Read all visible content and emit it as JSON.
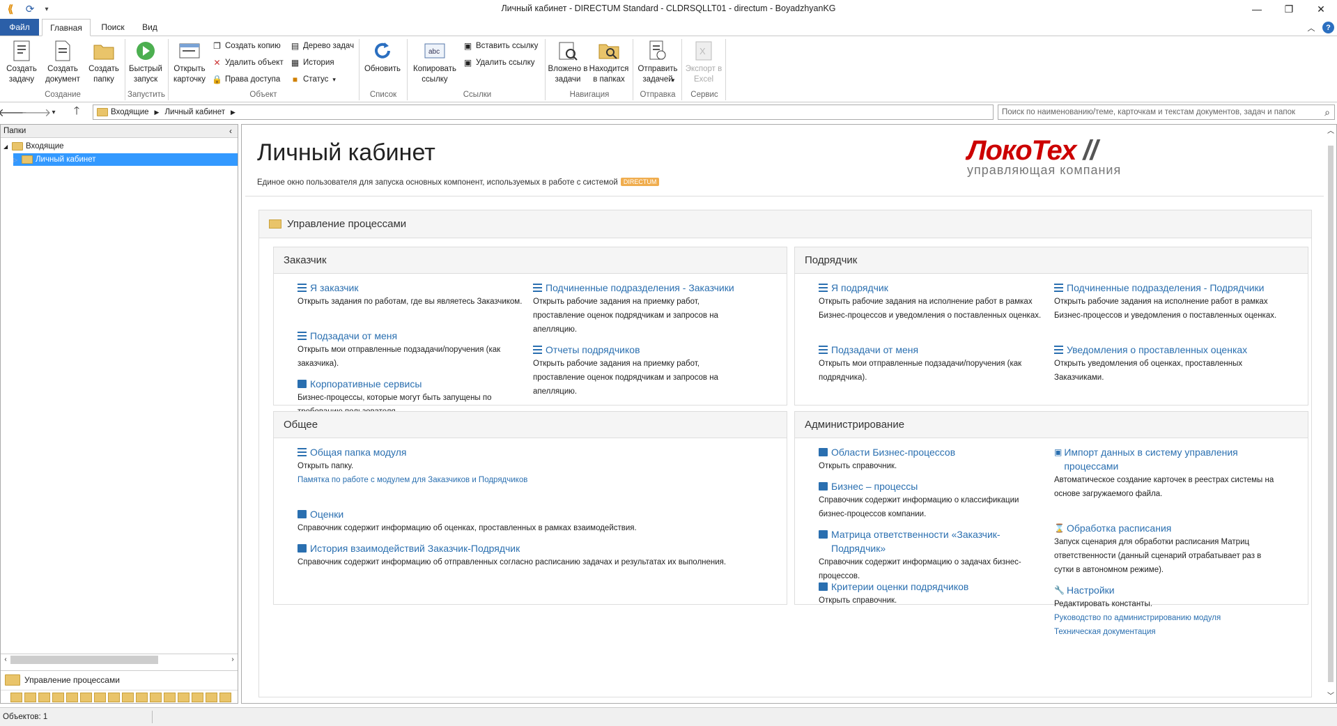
{
  "window": {
    "title": "Личный кабинет - DIRECTUM Standard - CLDRSQLLT01 - directum - BoyadzhyanKG"
  },
  "tabs": [
    "Файл",
    "Главная",
    "Поиск",
    "Вид"
  ],
  "ribbon": {
    "create_task": "Создать задачу",
    "create_doc": "Создать документ",
    "create_folder": "Создать папку",
    "group_create": "Создание",
    "quick_start": "Быстрый запуск",
    "group_run": "Запустить",
    "open_card": "Открыть карточку",
    "create_copy": "Создать копию",
    "delete_object": "Удалить объект",
    "access_rights": "Права доступа",
    "task_tree": "Дерево задач",
    "history": "История",
    "status": "Статус",
    "group_object": "Объект",
    "refresh": "Обновить",
    "group_list": "Список",
    "copy_link": "Копировать ссылку",
    "insert_link": "Вставить ссылку",
    "delete_link": "Удалить ссылку",
    "group_links": "Ссылки",
    "attached": "Вложено в задачи",
    "in_folders": "Находится в папках",
    "group_nav": "Навигация",
    "send_tasks": "Отправить задачей",
    "group_send": "Отправка",
    "export_excel": "Экспорт в Excel",
    "group_service": "Сервис"
  },
  "breadcrumb": {
    "root": "Входящие",
    "current": "Личный кабинет"
  },
  "search": {
    "placeholder": "Поиск по наименованию/теме, карточкам и текстам документов, задач и папок"
  },
  "left": {
    "header": "Папки",
    "tree": [
      "Входящие",
      "Личный кабинет"
    ],
    "navpane": "Управление процессами"
  },
  "page": {
    "title": "Личный кабинет",
    "subtitle": "Единое окно пользователя для запуска основных компонент, используемых в работе с системой",
    "badge": "DIRECTUM",
    "logo_main": "ЛокоТех",
    "logo_sub": "управляющая компания",
    "section": "Управление процессами"
  },
  "customer": {
    "header": "Заказчик",
    "items": [
      {
        "title": "Я заказчик",
        "desc": "Открыть задания по работам, где вы являетесь Заказчиком."
      },
      {
        "title": "Подзадачи от меня",
        "desc": "Открыть мои отправленные подзадачи/поручения (как заказчика)."
      },
      {
        "title": "Корпоративные сервисы",
        "desc": "Бизнес-процессы, которые могут быть запущены по требованию пользователя."
      },
      {
        "title": "Подчиненные подразделения - Заказчики",
        "desc": "Открыть рабочие задания на приемку работ, проставление оценок подрядчикам и запросов на апелляцию."
      },
      {
        "title": "Отчеты подрядчиков",
        "desc": "Открыть рабочие задания на приемку работ, проставление оценок подрядчикам и запросов на апелляцию."
      }
    ]
  },
  "contractor": {
    "header": "Подрядчик",
    "items": [
      {
        "title": "Я подрядчик",
        "desc": "Открыть рабочие задания на исполнение работ в рамках Бизнес-процессов и уведомления о поставленных оценках."
      },
      {
        "title": "Подзадачи от меня",
        "desc": "Открыть мои отправленные подзадачи/поручения (как подрядчика)."
      },
      {
        "title": "Подчиненные подразделения - Подрядчики",
        "desc": "Открыть рабочие задания на исполнение работ в рамках Бизнес-процессов и уведомления о поставленных оценках."
      },
      {
        "title": "Уведомления о проставленных оценках",
        "desc": "Открыть уведомления об оценках, проставленных Заказчиками."
      }
    ]
  },
  "general": {
    "header": "Общее",
    "items": [
      {
        "title": "Общая папка модуля",
        "desc": "Открыть папку.",
        "sub": "Памятка по работе с модулем для Заказчиков и Подрядчиков"
      },
      {
        "title": "Оценки",
        "desc": "Справочник содержит информацию об оценках, проставленных в рамках взаимодействия."
      },
      {
        "title": "История взаимодействий Заказчик-Подрядчик",
        "desc": "Справочник содержит информацию об отправленных согласно расписанию задачах и результатах их выполнения."
      }
    ]
  },
  "admin": {
    "header": "Администрирование",
    "items": [
      {
        "title": "Области Бизнес-процессов",
        "desc": "Открыть справочник."
      },
      {
        "title": "Бизнес – процессы",
        "desc": "Справочник содержит информацию о классификации бизнес-процессов компании."
      },
      {
        "title": "Матрица ответственности «Заказчик-Подрядчик»",
        "desc": "Справочник содержит информацию о задачах бизнес-процессов."
      },
      {
        "title": "Критерии оценки подрядчиков",
        "desc": "Открыть справочник."
      },
      {
        "title": "Импорт данных в систему управления процессами",
        "desc": "Автоматическое создание карточек в реестрах системы на основе загружаемого файла."
      },
      {
        "title": "Обработка расписания",
        "desc": "Запуск сценария для обработки расписания Матриц ответственности (данный сценарий отрабатывает раз в сутки в автономном режиме)."
      },
      {
        "title": "Настройки",
        "desc": "Редактировать константы.",
        "sub1": "Руководство по администрированию модуля",
        "sub2": "Техническая документация"
      }
    ]
  },
  "status": {
    "objects": "Объектов: 1"
  }
}
